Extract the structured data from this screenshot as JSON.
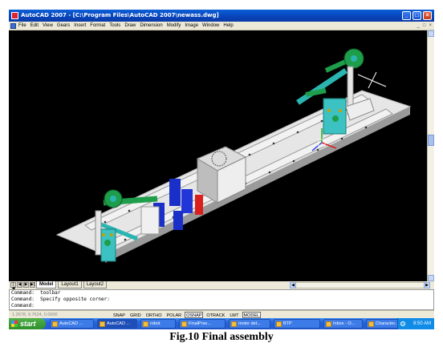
{
  "window": {
    "title": "AutoCAD 2007 - [C:\\Program Files\\AutoCAD 2007\\newass.dwg]"
  },
  "menubar": {
    "items": [
      "File",
      "Edit",
      "View",
      "Gears",
      "Insert",
      "Format",
      "Tools",
      "Draw",
      "Dimension",
      "Modify",
      "Image",
      "Window",
      "Help"
    ]
  },
  "layout_tabs": {
    "model": "Model",
    "layout1": "Layout1",
    "layout2": "Layout2"
  },
  "command_line": {
    "line1": "Command:  toolbar",
    "line2": "Command:  Specify opposite corner:",
    "line3": "Command:"
  },
  "statusbar": {
    "coords": "1.2678, 9.7624, 0.0000",
    "toggles": [
      "SNAP",
      "GRID",
      "ORTHO",
      "POLAR",
      "OSNAP",
      "OTRACK",
      "LWT",
      "MODEL"
    ],
    "on": [
      false,
      false,
      false,
      false,
      true,
      false,
      false,
      true
    ]
  },
  "taskbar": {
    "start": "start",
    "tasks": [
      "AutoCAD ...",
      "AutoCAD ...",
      "robot",
      "FinalPrse...",
      "motor det...",
      "BTP",
      "Inbox - O...",
      "Character..."
    ],
    "clock": "8:50 AM"
  },
  "caption": "Fig.10 Final assembly",
  "colors": {
    "canvas": "#000000",
    "frame": "#f2f2f2",
    "gear": "#1e9e4a",
    "arm": "#2bb5b0",
    "motor": "#1a2ec8",
    "bracket": "#3cc2c2",
    "accent": "#d9201c"
  }
}
